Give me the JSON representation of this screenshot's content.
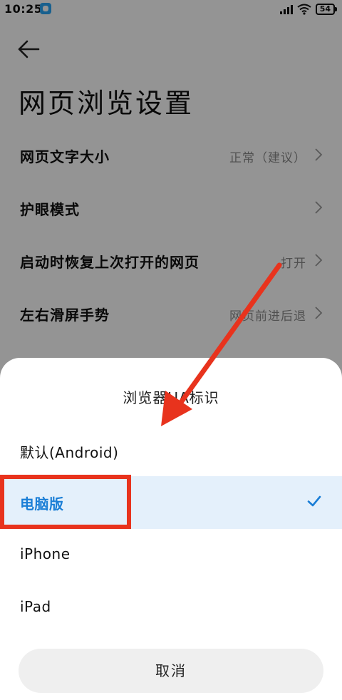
{
  "status_bar": {
    "time": "10:25",
    "battery": "54"
  },
  "page": {
    "title": "网页浏览设置",
    "settings": [
      {
        "label": "网页文字大小",
        "value": "正常（建议）"
      },
      {
        "label": "护眼模式",
        "value": ""
      },
      {
        "label": "启动时恢复上次打开的网页",
        "value": "打开"
      },
      {
        "label": "左右滑屏手势",
        "value": "网页前进后退"
      }
    ]
  },
  "sheet": {
    "title": "浏览器UA标识",
    "options": [
      {
        "label": "默认(Android)",
        "selected": false
      },
      {
        "label": "电脑版",
        "selected": true
      },
      {
        "label": "iPhone",
        "selected": false
      },
      {
        "label": "iPad",
        "selected": false
      }
    ],
    "cancel_label": "取消"
  },
  "colors": {
    "accent": "#1a7ed6",
    "selected_bg": "#e4f0fb",
    "annotation_red": "#e8331d"
  }
}
